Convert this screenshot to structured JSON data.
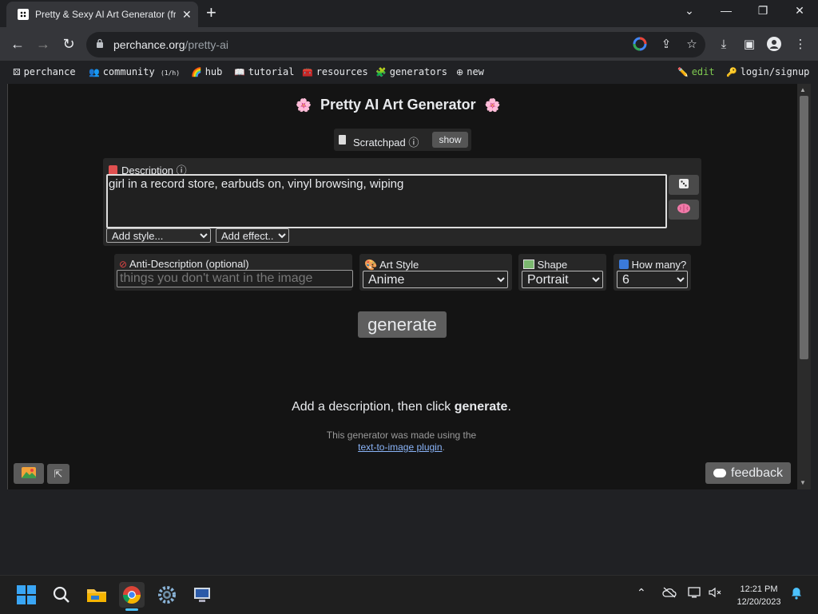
{
  "browser": {
    "tab_title": "Pretty & Sexy AI Art Generator (fr",
    "tab_close": "✕",
    "new_tab": "+",
    "url_host": "perchance.org",
    "url_path": "/pretty-ai",
    "window_controls": {
      "dropdown": "⌄",
      "minimize": "—",
      "restore": "❐",
      "close": "✕"
    },
    "nav": {
      "back": "←",
      "forward": "→",
      "reload": "↻"
    }
  },
  "site_nav": {
    "items": [
      {
        "icon": "dice-icon",
        "label": "perchance"
      },
      {
        "icon": "users-icon",
        "label": "community",
        "badge": "(1/h)"
      },
      {
        "icon": "rainbow-icon",
        "label": "hub"
      },
      {
        "icon": "book-icon",
        "label": "tutorial"
      },
      {
        "icon": "toolbox-icon",
        "label": "resources"
      },
      {
        "icon": "puzzle-icon",
        "label": "generators"
      },
      {
        "icon": "plus-circle-icon",
        "label": "new"
      }
    ],
    "edit": "edit",
    "login": "login/signup",
    "edit_color": "#7ec850"
  },
  "app": {
    "title": "Pretty AI Art Generator",
    "title_flower": "🌸",
    "scratchpad_label": "Scratchpad",
    "scratchpad_info": "ⓘ",
    "scratchpad_button": "show",
    "description_label": "Description",
    "description_info": "ⓘ",
    "description_value": "girl in a record store, earbuds on, vinyl browsing, wiping ",
    "add_style": "Add style...",
    "add_effect": "Add effect...",
    "anti_label": "Anti-Description (optional)",
    "anti_placeholder": "things you don't want in the image",
    "art_style_label": "Art Style",
    "art_style_value": "Anime",
    "shape_label": "Shape",
    "shape_value": "Portrait",
    "how_many_label": "How many?",
    "how_many_value": "6",
    "generate_button": "generate",
    "hint_prefix": "Add a description, then click ",
    "hint_bold": "generate",
    "hint_suffix": ".",
    "made_by": "This generator was made using the",
    "plugin_link": "text-to-image plugin",
    "plugin_link_suffix": ".",
    "expand_icon": "⇱",
    "feedback_label": "feedback"
  },
  "taskbar": {
    "time": "12:21 PM",
    "date": "12/20/2023",
    "tray_up": "⌃"
  }
}
